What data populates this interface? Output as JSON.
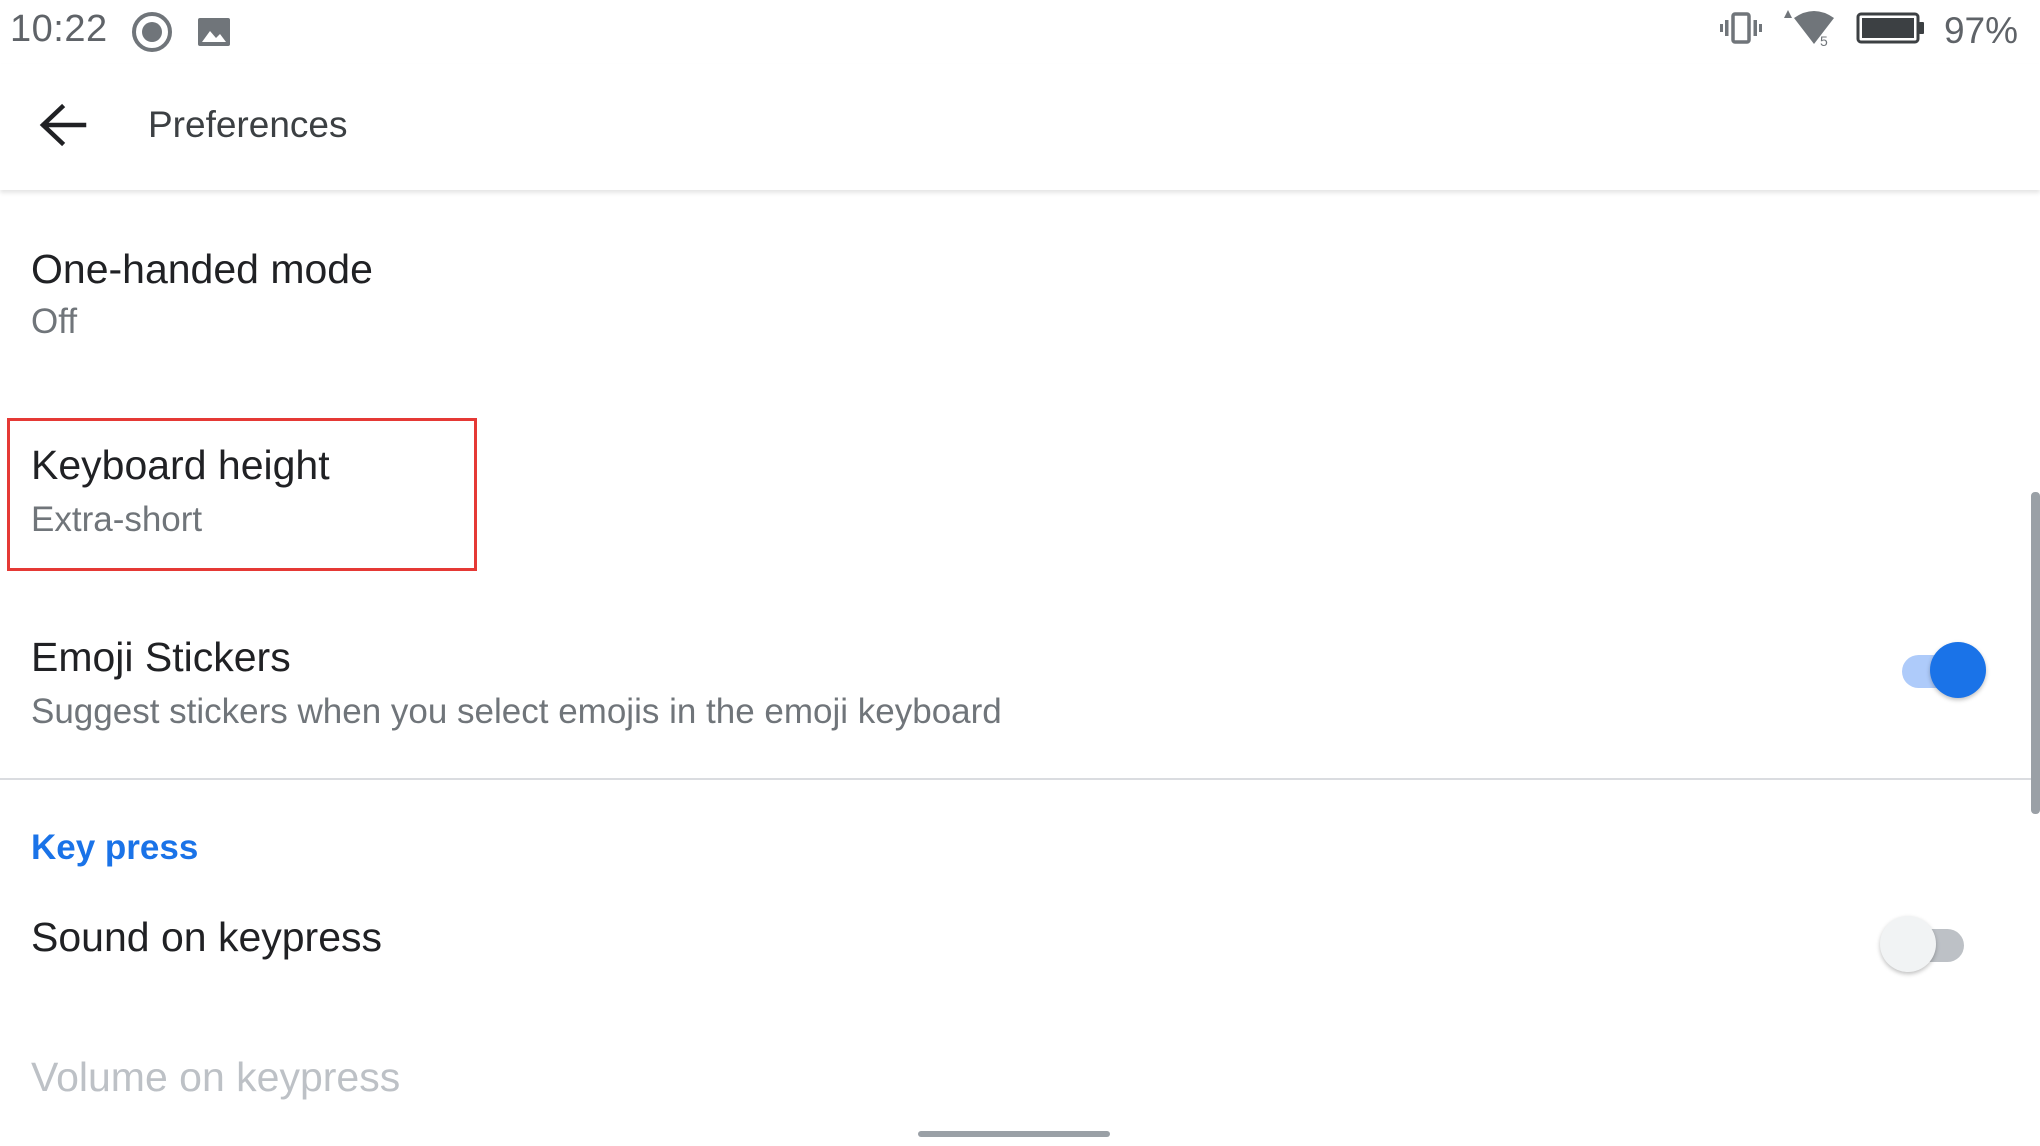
{
  "status_bar": {
    "time": "10:22",
    "battery_percent": "97%",
    "left_icons": [
      "record-icon",
      "image-icon"
    ],
    "right_icons": [
      "vibrate-icon",
      "wifi-icon",
      "battery-icon"
    ]
  },
  "app_bar": {
    "title": "Preferences",
    "back_icon": "arrow-back-icon"
  },
  "preferences": {
    "one_handed": {
      "title": "One-handed mode",
      "summary": "Off"
    },
    "keyboard_height": {
      "title": "Keyboard height",
      "summary": "Extra-short"
    },
    "emoji_stickers": {
      "title": "Emoji Stickers",
      "summary": "Suggest stickers when you select emojis in the emoji keyboard",
      "enabled": true
    },
    "key_press_section": "Key press",
    "sound_on_keypress": {
      "title": "Sound on keypress",
      "enabled": false
    },
    "volume_on_keypress": {
      "title": "Volume on keypress"
    }
  },
  "colors": {
    "accent": "#1a73e8",
    "highlight_border": "#e53935"
  }
}
